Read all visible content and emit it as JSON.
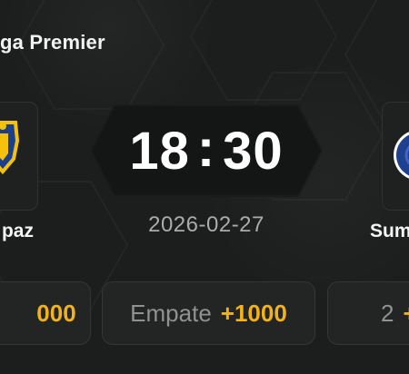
{
  "league": {
    "title": "ga Premier"
  },
  "match": {
    "time_hour": "18",
    "time_sep": ":",
    "time_minute": "30",
    "date": "2026-02-27"
  },
  "home_team": {
    "name": "paz",
    "logo_icon": "club-crest-icon",
    "logo_colors": {
      "primary": "#f4c20d",
      "secondary": "#1b3f8b"
    }
  },
  "away_team": {
    "name": "Sum",
    "logo_icon": "club-crest-icon",
    "logo_colors": {
      "primary": "#1f3f8f",
      "secondary": "#ffffff"
    }
  },
  "odds": {
    "home": {
      "label": "",
      "value": "000"
    },
    "draw": {
      "label": "Empate",
      "value": "+1000"
    },
    "away": {
      "label": "2",
      "value": "+"
    }
  },
  "colors": {
    "background": "#1c1e1d",
    "accent": "#f2b21d",
    "time_badge": "#141615"
  }
}
